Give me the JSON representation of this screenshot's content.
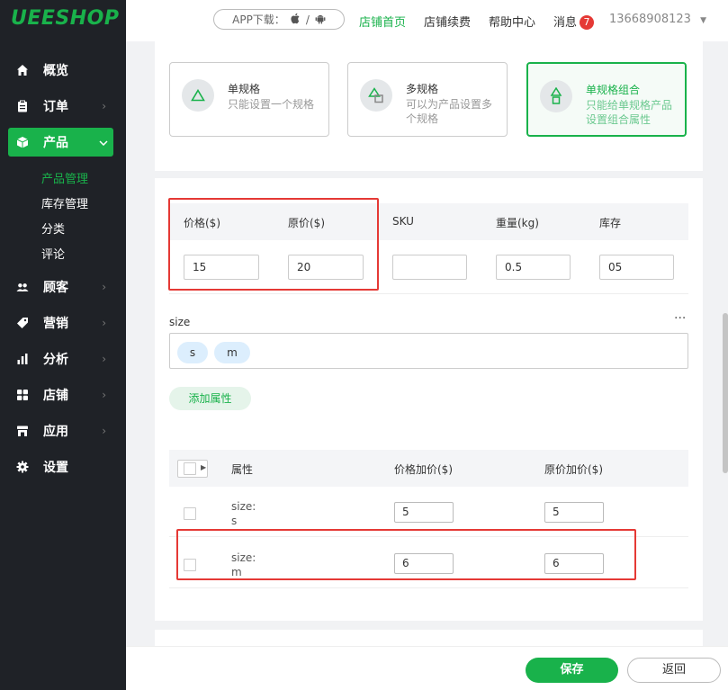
{
  "app": {
    "logo": "UEESHOP",
    "brand_color": "#19b24b"
  },
  "sidebar": {
    "items": [
      {
        "label": "概览",
        "icon": "home-icon"
      },
      {
        "label": "订单",
        "icon": "clipboard-icon"
      },
      {
        "label": "产品",
        "icon": "box-icon"
      },
      {
        "label": "顾客",
        "icon": "users-icon"
      },
      {
        "label": "营销",
        "icon": "tag-icon"
      },
      {
        "label": "分析",
        "icon": "bar-chart-icon"
      },
      {
        "label": "店铺",
        "icon": "grid-icon"
      },
      {
        "label": "应用",
        "icon": "store-icon"
      },
      {
        "label": "设置",
        "icon": "gear-icon"
      }
    ],
    "product_sub": [
      "产品管理",
      "库存管理",
      "分类",
      "评论"
    ]
  },
  "topbar": {
    "app_download": "APP下载：",
    "slash": "/",
    "links": [
      "店铺首页",
      "店铺续费",
      "帮助中心"
    ],
    "messages_label": "消息",
    "messages_count": "7",
    "account": "13668908123"
  },
  "spec_types": [
    {
      "title": "单规格",
      "desc": "只能设置一个规格"
    },
    {
      "title": "多规格",
      "desc": "可以为产品设置多个规格"
    },
    {
      "title": "单规格组合",
      "desc": "只能给单规格产品设置组合属性"
    }
  ],
  "price_table": {
    "headers": [
      "价格($)",
      "原价($)",
      "SKU",
      "重量(kg)",
      "库存"
    ],
    "values": [
      "15",
      "20",
      "",
      "0.5",
      "05"
    ]
  },
  "attribute": {
    "name": "size",
    "more": "···",
    "tags": [
      "s",
      "m"
    ],
    "add_button": "添加属性"
  },
  "combo_table": {
    "headers": [
      "属性",
      "价格加价($)",
      "原价加价($)"
    ],
    "rows": [
      {
        "attr_line1": "size:",
        "attr_line2": "s",
        "price_add": "5",
        "orig_add": "5"
      },
      {
        "attr_line1": "size:",
        "attr_line2": "m",
        "price_add": "6",
        "orig_add": "6"
      }
    ]
  },
  "footer": {
    "save": "保存",
    "back": "返回"
  }
}
